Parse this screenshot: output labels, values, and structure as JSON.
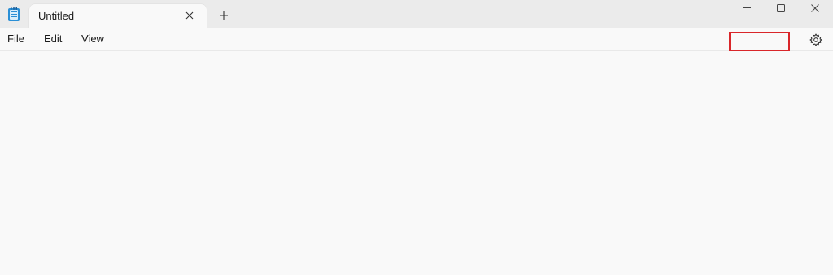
{
  "app": {
    "icon": "notepad-icon"
  },
  "tab": {
    "title": "Untitled",
    "close_icon": "close-icon"
  },
  "new_tab_icon": "plus-icon",
  "window_controls": {
    "minimize_icon": "minimize-icon",
    "maximize_icon": "maximize-icon",
    "close_icon": "close-icon"
  },
  "menu": {
    "items": [
      {
        "label": "File"
      },
      {
        "label": "Edit"
      },
      {
        "label": "View"
      }
    ]
  },
  "settings_icon": "gear-icon",
  "colors": {
    "highlight": "#d9262a",
    "titlebar": "#ebebeb",
    "background": "#f9f9f9"
  },
  "editor": {
    "content": ""
  }
}
